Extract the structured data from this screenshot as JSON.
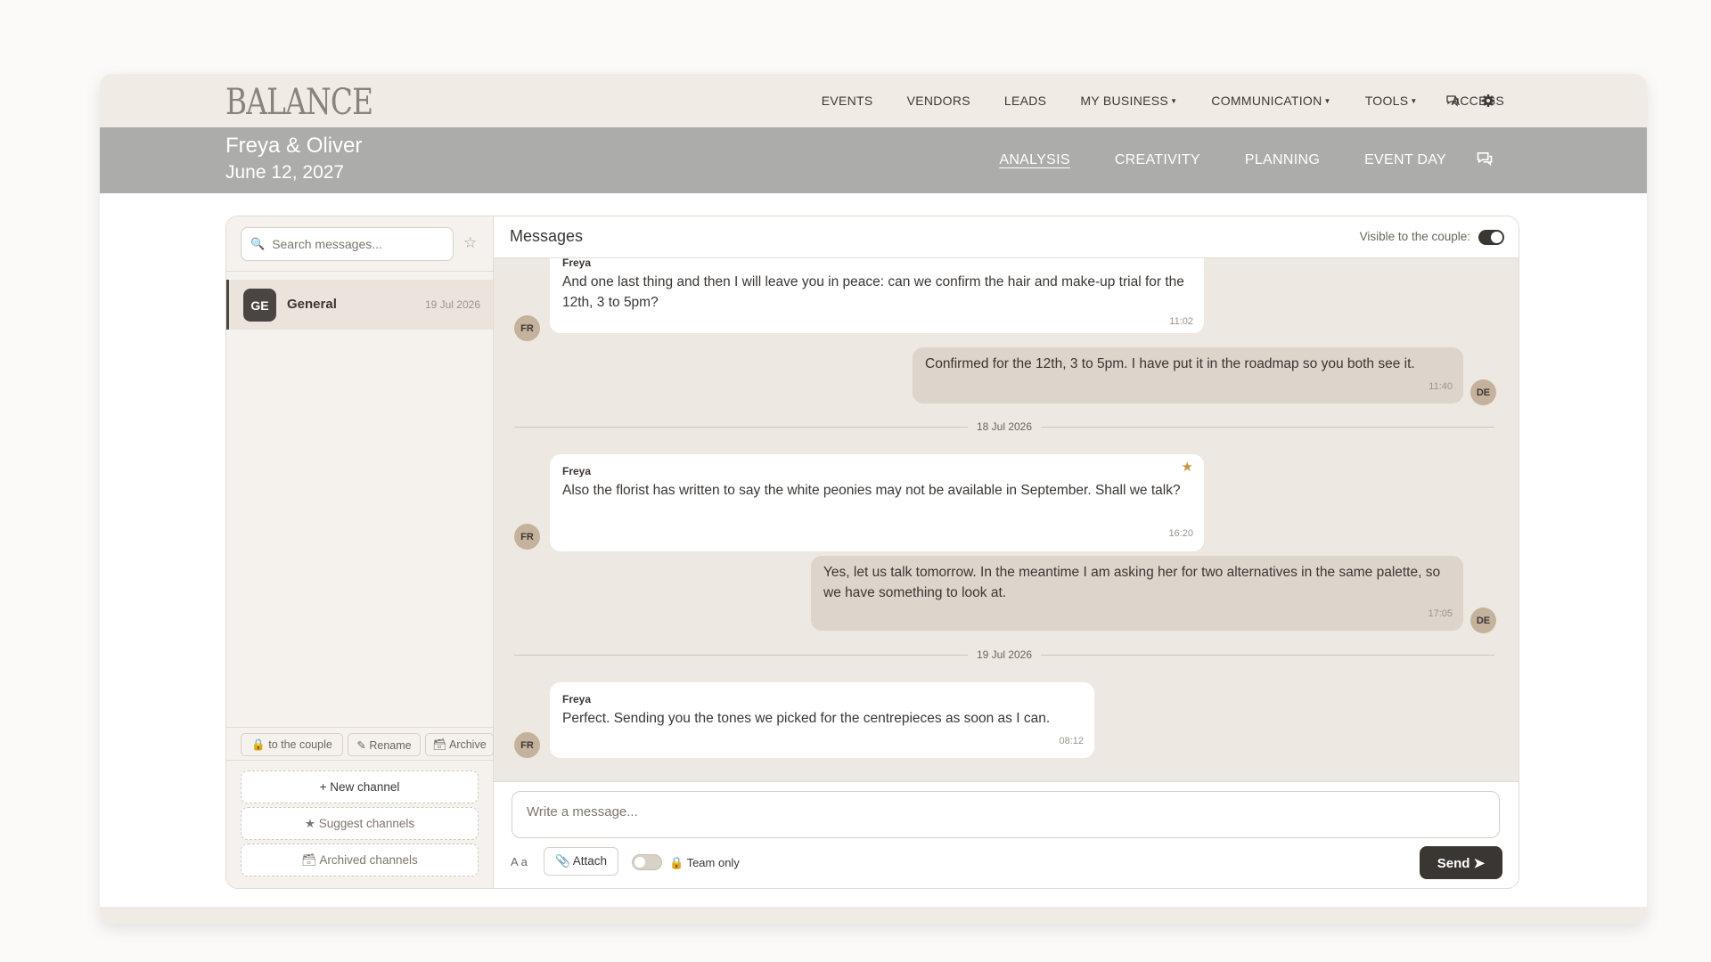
{
  "app": {
    "logo": "BALANCE"
  },
  "nav": {
    "items": [
      {
        "label": "EVENTS",
        "dropdown": false
      },
      {
        "label": "VENDORS",
        "dropdown": false
      },
      {
        "label": "LEADS",
        "dropdown": false
      },
      {
        "label": "MY BUSINESS",
        "dropdown": true
      },
      {
        "label": "COMMUNICATION",
        "dropdown": true
      },
      {
        "label": "TOOLS",
        "dropdown": true
      },
      {
        "label": "ACCESS",
        "dropdown": false
      }
    ],
    "icons": [
      "chat-icon",
      "gear-icon"
    ]
  },
  "event": {
    "couple": "Freya & Oliver",
    "date": "June 12, 2027",
    "tabs": [
      "ANALYSIS",
      "CREATIVITY",
      "PLANNING",
      "EVENT DAY"
    ],
    "active_tab": "ANALYSIS"
  },
  "sidebar": {
    "search_placeholder": "Search messages...",
    "channels": [
      {
        "initials": "GE",
        "name": "General",
        "date": "19 Jul 2026",
        "active": true
      }
    ],
    "actions": {
      "couple": "🔒 to the couple",
      "rename": "✎ Rename",
      "archive": "🗃 Archive"
    },
    "new_channel": "+ New channel",
    "suggest_channels": "★ Suggest channels",
    "archived_channels": "🗃 Archived channels"
  },
  "messages_panel": {
    "title": "Messages",
    "visible_label": "Visible to the couple:",
    "visible_to_couple": true,
    "separators": [
      "18 Jul 2026",
      "19 Jul 2026"
    ],
    "messages": [
      {
        "sender": "Freya",
        "initials": "FR",
        "direction": "in",
        "text": "And one last thing and then I will leave you in peace: can we confirm the hair and make-up trial for the 12th, 3 to 5pm?",
        "time": "11:02",
        "starred": false
      },
      {
        "sender": "",
        "initials": "DE",
        "direction": "out",
        "text": "Confirmed for the 12th, 3 to 5pm. I have put it in the roadmap so you both see it.",
        "time": "11:40",
        "starred": false
      },
      {
        "sender": "Freya",
        "initials": "FR",
        "direction": "in",
        "text": "Also the florist has written to say the white peonies may not be available in September. Shall we talk?",
        "time": "16:20",
        "starred": true
      },
      {
        "sender": "",
        "initials": "DE",
        "direction": "out",
        "text": "Yes, let us talk tomorrow. In the meantime I am asking her for two alternatives in the same palette, so we have something to look at.",
        "time": "17:05",
        "starred": false
      },
      {
        "sender": "Freya",
        "initials": "FR",
        "direction": "in",
        "text": "Perfect. Sending you the tones we picked for the centrepieces as soon as I can.",
        "time": "08:12",
        "starred": false
      }
    ]
  },
  "composer": {
    "placeholder": "Write a message...",
    "format_label": "A a",
    "attach_label": "📎 Attach",
    "team_only_label": "🔒 Team only",
    "team_only": false,
    "send_label": "Send ➤"
  },
  "colors": {
    "nav_bg": "#f0ebe4",
    "event_bar": "#acacab",
    "accent_dark": "#3a3632",
    "bubble_out": "#ddd5cc",
    "chat_bg": "#ede8e2",
    "avatar": "#c4b29c",
    "star": "#c9953e"
  }
}
